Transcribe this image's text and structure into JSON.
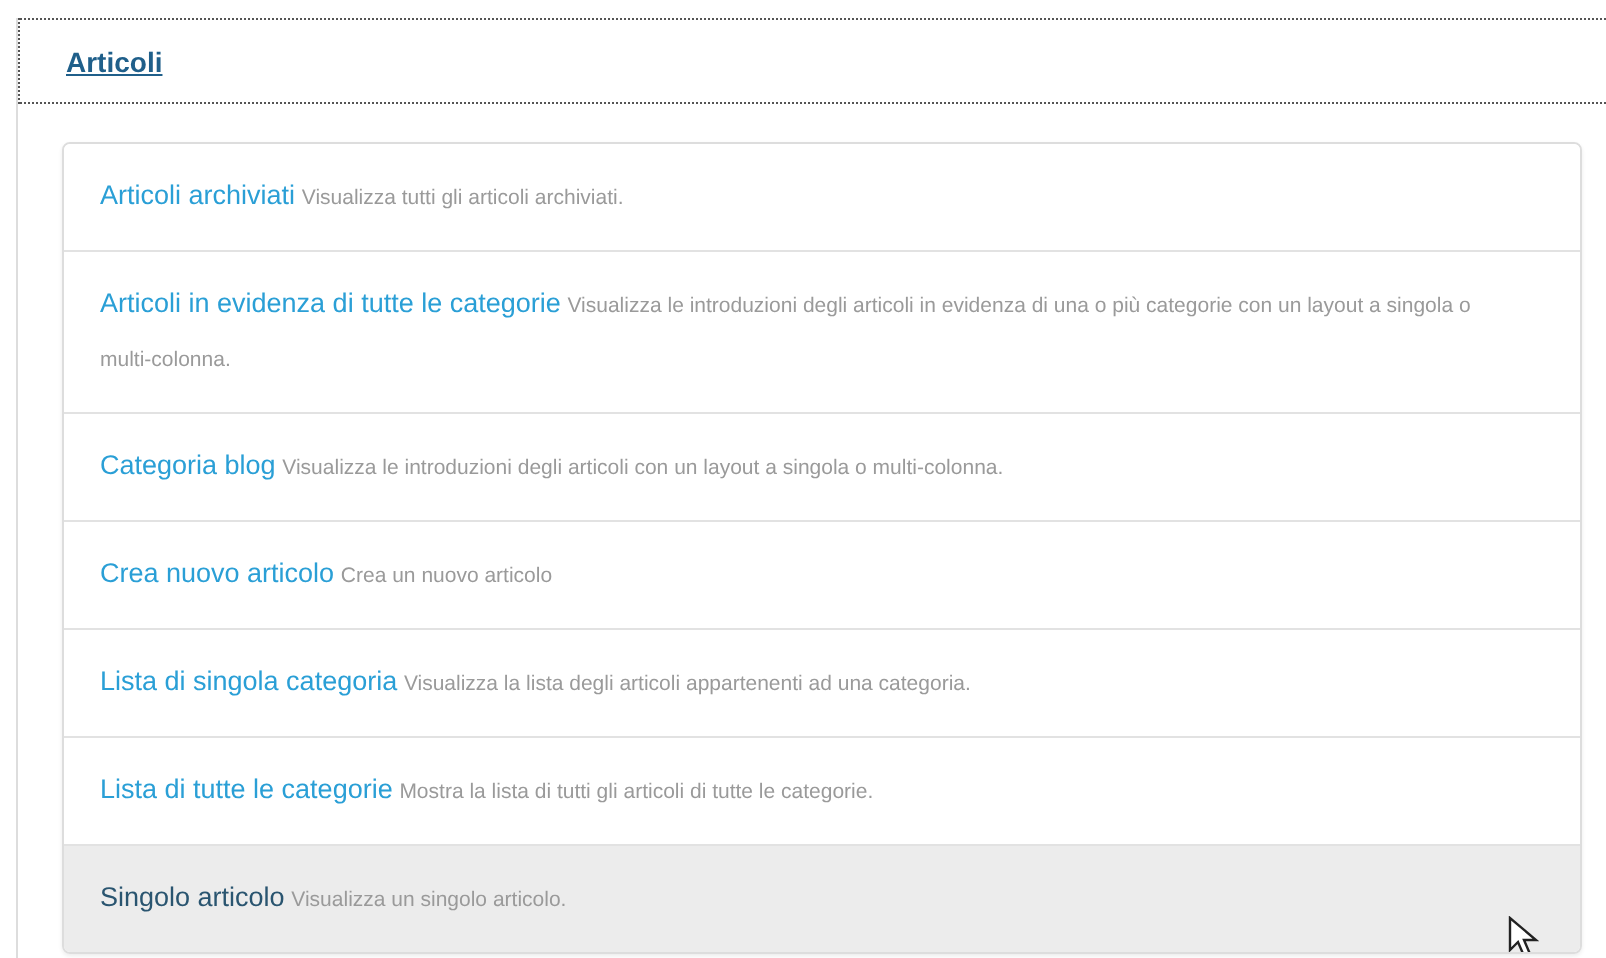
{
  "section": {
    "title": "Articoli"
  },
  "items": [
    {
      "title": "Articoli archiviati",
      "description": "Visualizza tutti gli articoli archiviati.",
      "hovered": false
    },
    {
      "title": "Articoli in evidenza di tutte le categorie",
      "description": "Visualizza le introduzioni degli articoli in evidenza di una o più categorie con un layout a singola o multi-colonna.",
      "hovered": false
    },
    {
      "title": "Categoria blog",
      "description": "Visualizza le introduzioni degli articoli con un layout a singola o multi-colonna.",
      "hovered": false
    },
    {
      "title": "Crea nuovo articolo",
      "description": "Crea un nuovo articolo",
      "hovered": false
    },
    {
      "title": "Lista di singola categoria",
      "description": "Visualizza la lista degli articoli appartenenti ad una categoria.",
      "hovered": false
    },
    {
      "title": "Lista di tutte le categorie",
      "description": "Mostra la lista di tutti gli articoli di tutte le categorie.",
      "hovered": false
    },
    {
      "title": "Singolo articolo",
      "description": "Visualizza un singolo articolo.",
      "hovered": true
    }
  ]
}
